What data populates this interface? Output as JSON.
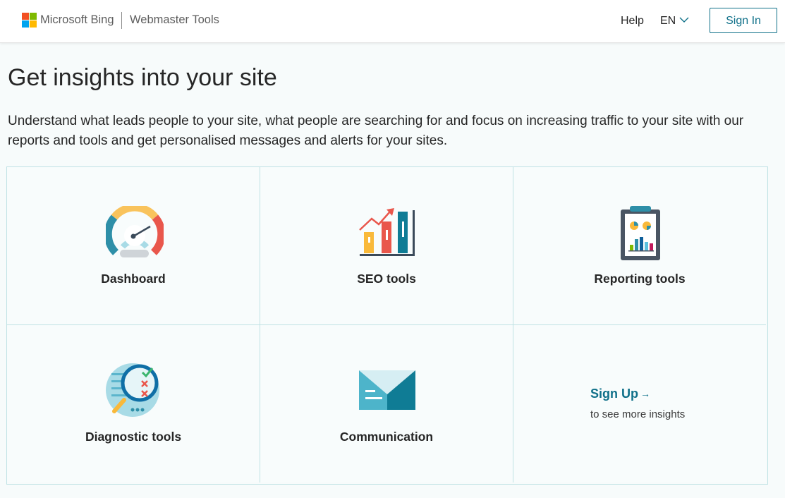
{
  "header": {
    "brand": "Microsoft Bing",
    "product": "Webmaster Tools",
    "help": "Help",
    "language": "EN",
    "sign_in": "Sign In",
    "logo_colors": [
      "#f25022",
      "#7fba00",
      "#00a4ef",
      "#ffb900"
    ]
  },
  "main": {
    "title": "Get insights into your site",
    "description": "Understand what leads people to your site, what people are searching for and focus on increasing traffic to your site with our reports and tools and get personalised messages and alerts for your sites."
  },
  "tiles": [
    {
      "label": "Dashboard",
      "icon": "speedometer-icon"
    },
    {
      "label": "SEO tools",
      "icon": "bar-chart-trend-icon"
    },
    {
      "label": "Reporting tools",
      "icon": "clipboard-report-icon"
    },
    {
      "label": "Diagnostic tools",
      "icon": "magnifier-checklist-icon"
    },
    {
      "label": "Communication",
      "icon": "envelope-icon"
    }
  ],
  "signup": {
    "link": "Sign Up",
    "arrow": "→",
    "subtext": "to see more insights"
  },
  "colors": {
    "accent": "#0f7089",
    "tile_border": "#bfe2e4",
    "background": "#f7fbfb"
  }
}
